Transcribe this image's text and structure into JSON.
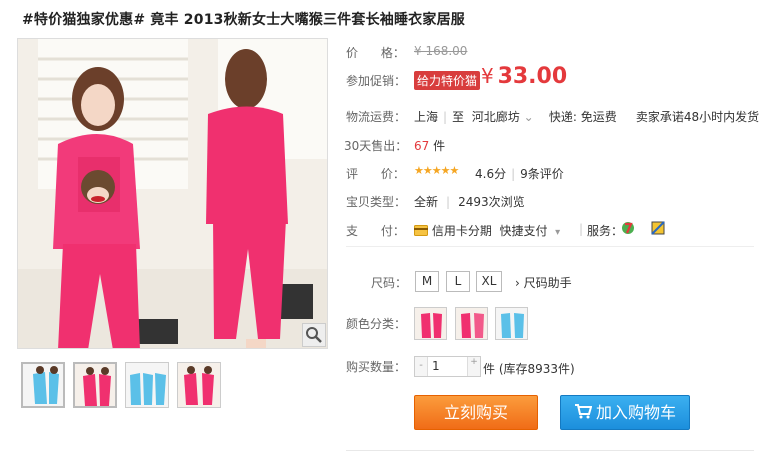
{
  "product": {
    "title": "#特价猫独家优惠# 竟丰 2013秋新女士大嘴猴三件套长袖睡衣家居服"
  },
  "price": {
    "label": "价      格：",
    "original": "¥ 168.00"
  },
  "promo": {
    "label": "参加促销：",
    "tag": "给力特价猫",
    "currency": "¥",
    "price": "33.00"
  },
  "shipping": {
    "label": "物流运费：",
    "from": "上海",
    "to_sep": "至",
    "to": "河北廊坊",
    "fee": "快递: 免运费",
    "promise": "卖家承诺48小时内发货"
  },
  "sales": {
    "label": "30天售出：",
    "count": "67",
    "unit": "件"
  },
  "rating": {
    "label": "评      价：",
    "stars": "★★★★★",
    "score": "4.6分",
    "reviews": "9条评价"
  },
  "item_type": {
    "label": "宝贝类型：",
    "condition": "全新",
    "views": "2493次浏览"
  },
  "payment": {
    "label": "支      付：",
    "credit": "信用卡分期",
    "quick": "快捷支付",
    "service_label": "服务："
  },
  "size": {
    "label": "尺码：",
    "options": [
      "M",
      "L",
      "XL"
    ],
    "helper": "尺码助手"
  },
  "color": {
    "label": "颜色分类："
  },
  "quantity": {
    "label": "购买数量：",
    "minus": "-",
    "plus": "+",
    "value": "1",
    "stock": "件 (库存8933件)"
  },
  "actions": {
    "buy": "立刻购买",
    "cart": "加入购物车"
  },
  "colors": {
    "pink": "#f0306f",
    "promo_red": "#e4393c",
    "buy_orange": "#f06c17",
    "cart_blue": "#1c8fdc"
  }
}
